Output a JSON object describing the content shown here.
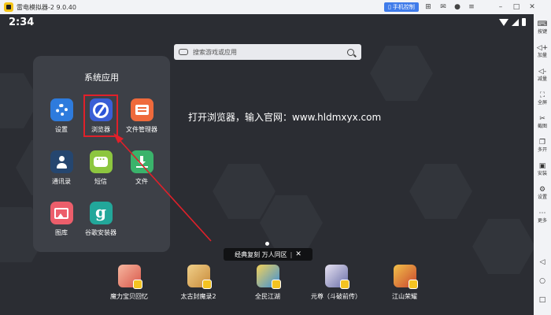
{
  "titlebar": {
    "title": "雷电模拟器-2 9.0.40",
    "phone_control": "手机控制",
    "icons": [
      "gamepad-icon",
      "mail-icon",
      "user-icon",
      "menu-icon",
      "minimize-icon",
      "maximize-icon",
      "close-icon"
    ]
  },
  "status": {
    "time": "2:34"
  },
  "search": {
    "placeholder": "搜索游戏或应用"
  },
  "folder": {
    "title": "系统应用",
    "apps": [
      {
        "label": "设置",
        "color": "#2e7bdd",
        "icon": "settings-icon"
      },
      {
        "label": "浏览器",
        "color": "#3a5fd6",
        "icon": "browser-icon"
      },
      {
        "label": "文件管理器",
        "color": "#ef6a3c",
        "icon": "folder-icon"
      },
      {
        "label": "通讯录",
        "color": "#25466f",
        "icon": "contacts-icon"
      },
      {
        "label": "短信",
        "color": "#8dc63f",
        "icon": "sms-icon"
      },
      {
        "label": "文件",
        "color": "#3ab36b",
        "icon": "download-icon"
      },
      {
        "label": "图库",
        "color": "#ec5e6b",
        "icon": "gallery-icon"
      },
      {
        "label": "谷歌安装器",
        "color": "#22a79a",
        "icon": "google-installer-icon"
      }
    ]
  },
  "instruction": "打开浏览器，输入官网：www.hldmxyx.com",
  "banner": {
    "text": "经典复刻 万人同区",
    "sep": "|",
    "close": "✕"
  },
  "dock": [
    {
      "label": "魔力宝贝回忆",
      "color": "#d9574a"
    },
    {
      "label": "太古封魔录2",
      "color": "#c88a3a"
    },
    {
      "label": "全民江湖",
      "color": "#3b8fd8"
    },
    {
      "label": "元尊（斗破前传）",
      "color": "#6a6fa8"
    },
    {
      "label": "江山荣耀",
      "color": "#c9452e"
    }
  ],
  "sidebar": [
    {
      "icon": "⌨",
      "label": "按键",
      "name": "keymap"
    },
    {
      "icon": "◁+",
      "label": "加量",
      "name": "volume-up"
    },
    {
      "icon": "◁-",
      "label": "减量",
      "name": "volume-down"
    },
    {
      "icon": "⛶",
      "label": "全屏",
      "name": "fullscreen"
    },
    {
      "icon": "✂",
      "label": "截图",
      "name": "screenshot"
    },
    {
      "icon": "❐",
      "label": "多开",
      "name": "multi-instance"
    },
    {
      "icon": "▣",
      "label": "安装",
      "name": "install"
    },
    {
      "icon": "⚙",
      "label": "设置",
      "name": "settings"
    },
    {
      "icon": "⋯",
      "label": "更多",
      "name": "more"
    },
    {
      "icon": "◁",
      "label": "",
      "name": "back"
    },
    {
      "icon": "○",
      "label": "",
      "name": "home"
    },
    {
      "icon": "□",
      "label": "",
      "name": "recents"
    }
  ],
  "colors": {
    "highlight": "#e0202a",
    "accent": "#3f7bea"
  }
}
